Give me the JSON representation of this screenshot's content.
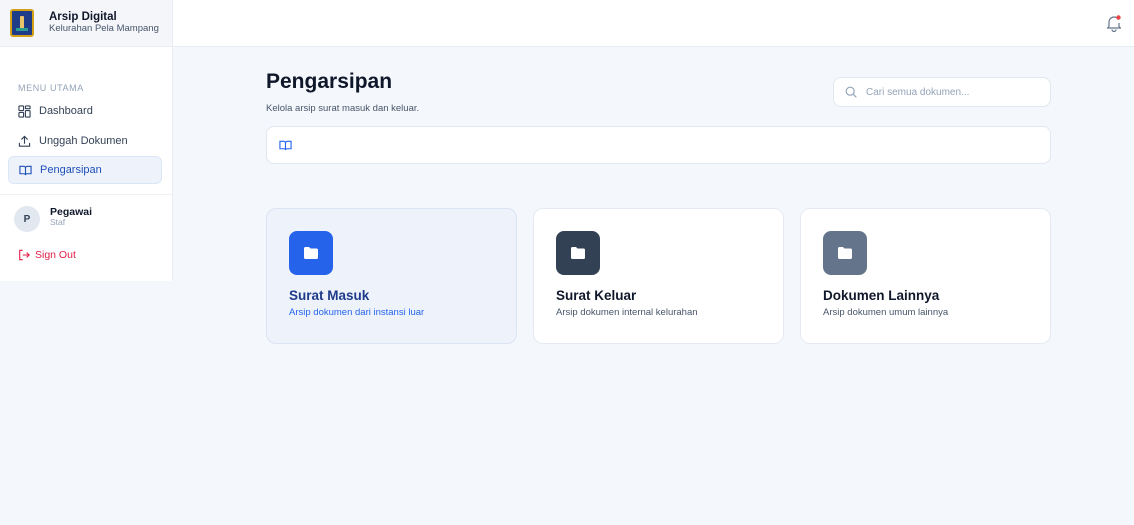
{
  "brand": {
    "title": "Arsip Digital",
    "subtitle": "Kelurahan Pela Mampang"
  },
  "sidebar": {
    "heading": "MENU UTAMA",
    "items": [
      {
        "label": "Dashboard",
        "icon": "dashboard-grid-icon"
      },
      {
        "label": "Unggah Dokumen",
        "icon": "upload-icon"
      },
      {
        "label": "Pengarsipan",
        "icon": "book-open-icon",
        "active": true
      }
    ]
  },
  "user": {
    "initial": "P",
    "name": "Pegawai",
    "role": "Staf"
  },
  "signout": {
    "label": "Sign Out",
    "icon": "sign-out-icon"
  },
  "header": {
    "icon": "bell-icon"
  },
  "main": {
    "title": "Pengarsipan",
    "subtitle": "Kelola arsip surat masuk dan keluar.",
    "search": {
      "placeholder": "Cari semua dokumen..."
    },
    "breadcrumb_icon": "book-open-icon",
    "cards": [
      {
        "title": "Surat Masuk",
        "desc": "Arsip dokumen dari instansi luar",
        "color": "#2563eb",
        "active": true
      },
      {
        "title": "Surat Keluar",
        "desc": "Arsip dokumen internal kelurahan",
        "color": "#334155"
      },
      {
        "title": "Dokumen Lainnya",
        "desc": "Arsip dokumen umum lainnya",
        "color": "#64748b"
      }
    ]
  },
  "colors": {
    "accent": "#2563eb",
    "danger": "#e11d48",
    "notification_dot": "#ef4444"
  }
}
